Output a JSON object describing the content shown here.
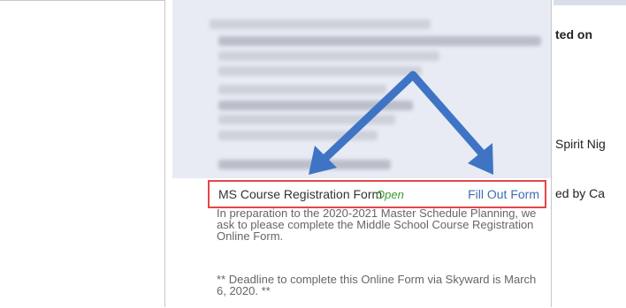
{
  "form": {
    "name": "MS Course Registration Form",
    "status": "Open",
    "action": "Fill Out Form",
    "description": "In preparation to the 2020-2021 Master Schedule Planning, we ask to please complete the Middle School Course Registration Online Form.",
    "deadline": "** Deadline to complete this Online Form via Skyward is March 6, 2020. **"
  },
  "right_column": {
    "heading_fragment": "ted on",
    "line_1_fragment": "Spirit Nig",
    "line_2_fragment": "ed by Ca"
  },
  "colors": {
    "highlight_border": "#e2474a",
    "annotation_arrow": "#3f74c5",
    "open_status": "#3a9a2a",
    "link": "#3c6fb0"
  },
  "icons": [
    "arrow-to-form-name",
    "arrow-to-fill-out-link"
  ]
}
